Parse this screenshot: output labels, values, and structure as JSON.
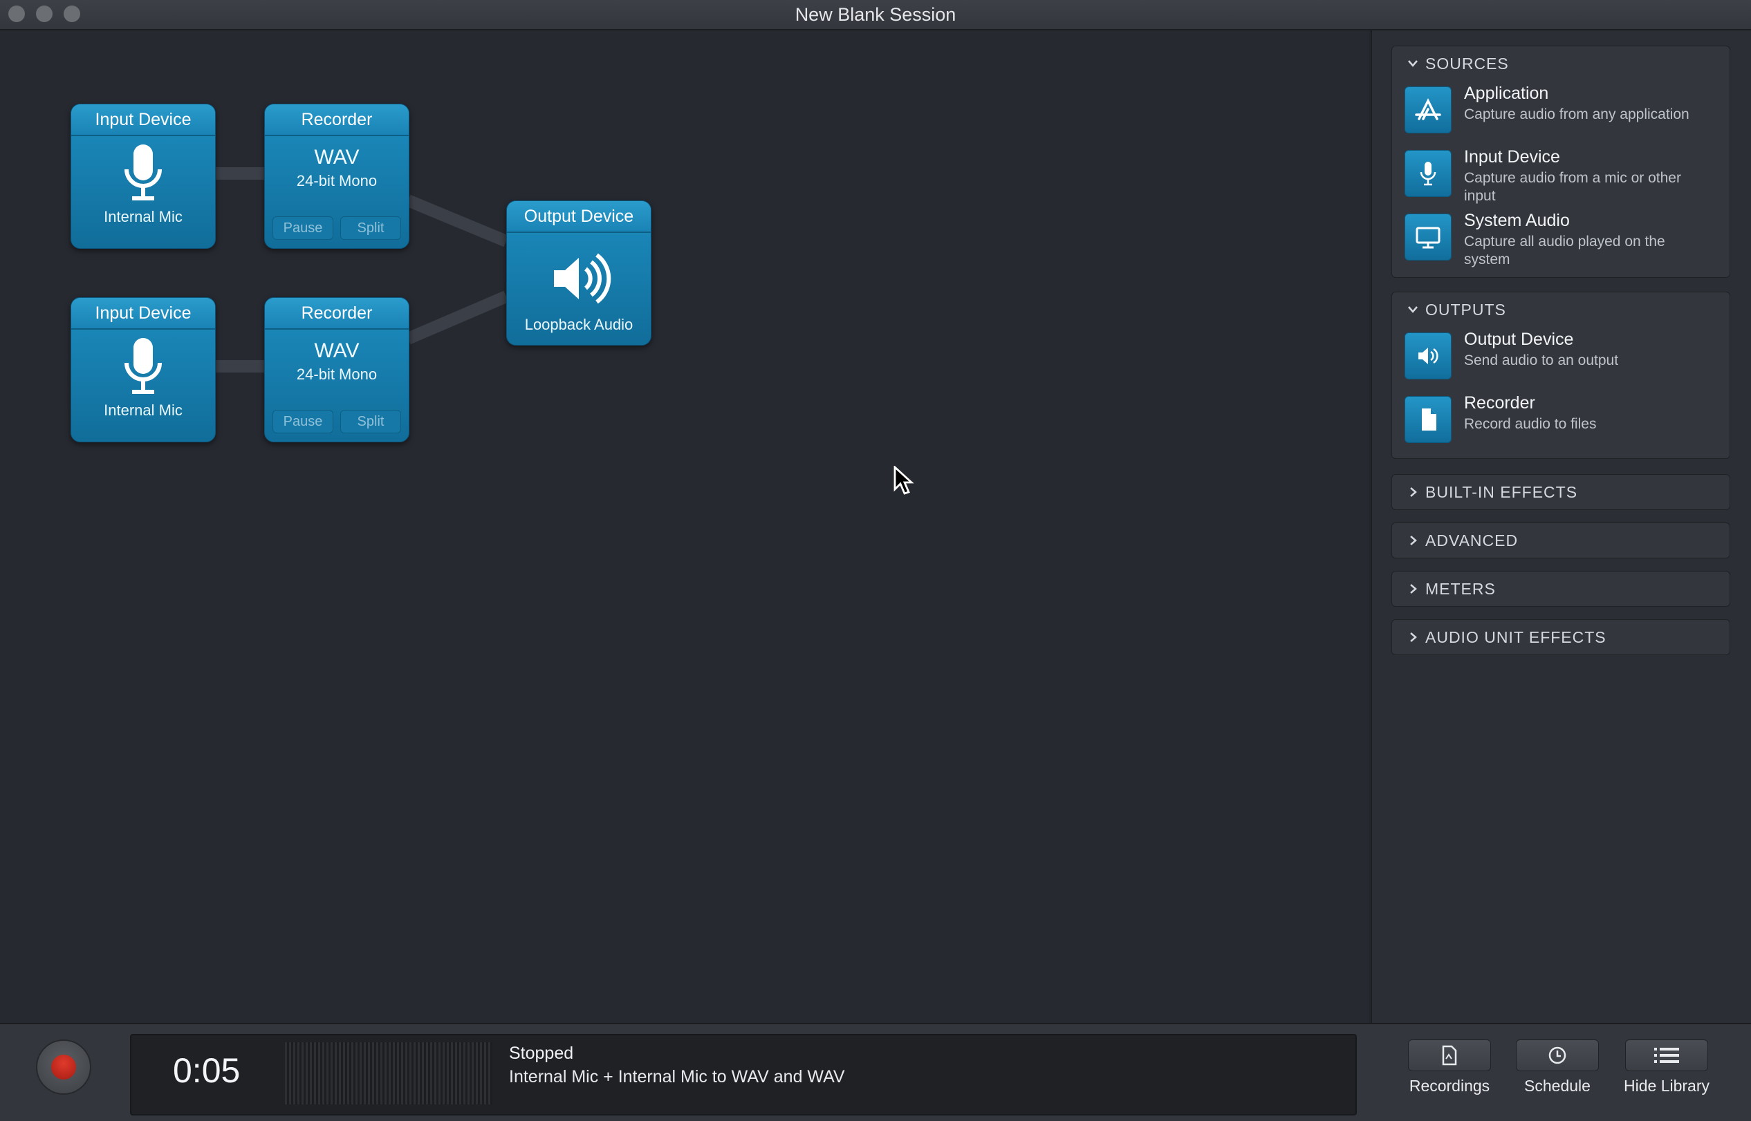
{
  "window": {
    "title": "New Blank Session"
  },
  "canvas": {
    "nodes": [
      {
        "header": "Input Device",
        "label": "Internal Mic"
      },
      {
        "header": "Recorder",
        "format": "WAV",
        "bits": "24-bit Mono",
        "pause": "Pause",
        "split": "Split"
      },
      {
        "header": "Input Device",
        "label": "Internal Mic"
      },
      {
        "header": "Recorder",
        "format": "WAV",
        "bits": "24-bit Mono",
        "pause": "Pause",
        "split": "Split"
      },
      {
        "header": "Output Device",
        "label": "Loopback Audio"
      }
    ]
  },
  "library": {
    "sources": {
      "title": "SOURCES",
      "items": [
        {
          "title": "Application",
          "desc": "Capture audio from any application",
          "icon": "application-icon"
        },
        {
          "title": "Input Device",
          "desc": "Capture audio from a mic or other input",
          "icon": "microphone-icon"
        },
        {
          "title": "System Audio",
          "desc": "Capture all audio played on the system",
          "icon": "monitor-icon"
        }
      ]
    },
    "outputs": {
      "title": "OUTPUTS",
      "items": [
        {
          "title": "Output Device",
          "desc": "Send audio to an output",
          "icon": "speaker-icon"
        },
        {
          "title": "Recorder",
          "desc": "Record audio to files",
          "icon": "document-icon"
        }
      ]
    },
    "collapsed": [
      "BUILT-IN EFFECTS",
      "ADVANCED",
      "METERS",
      "AUDIO UNIT EFFECTS"
    ]
  },
  "bottom": {
    "timer": "0:05",
    "status": "Stopped",
    "description": "Internal Mic + Internal Mic to WAV and WAV",
    "buttons": {
      "recordings": "Recordings",
      "schedule": "Schedule",
      "hide_library": "Hide Library"
    }
  },
  "colors": {
    "node": "#1c8dbf",
    "record": "#d1301f",
    "background": "#24272d"
  }
}
